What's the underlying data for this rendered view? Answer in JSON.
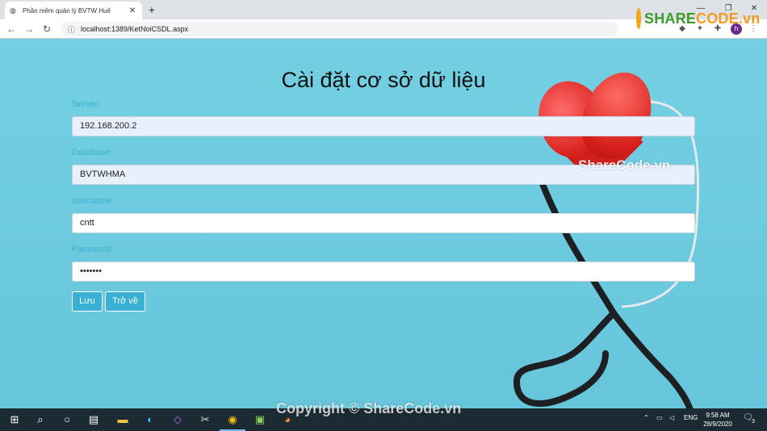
{
  "browser": {
    "tab_title": "Phần mềm quản lý BVTW Huế",
    "tab_favicon": "globe-icon",
    "url": "localhost:1389/KetNoiCSDL.aspx",
    "profile_initial": "h"
  },
  "watermark": {
    "logo_prefix": "SHARE",
    "logo_suffix": "CODE.vn",
    "site_text": "ShareCode.vn",
    "copyright_text": "Copyright © ShareCode.vn"
  },
  "form": {
    "heading": "Cài đặt cơ sở dữ liệu",
    "fields": [
      {
        "label": "Server:",
        "value": "192.168.200.2"
      },
      {
        "label": "Database:",
        "value": "BVTWHMA"
      },
      {
        "label": "username:",
        "value": "cntt"
      },
      {
        "label": "Password:",
        "value": "•••••••"
      }
    ],
    "save_label": "Lưu",
    "back_label": "Trở về"
  },
  "taskbar": {
    "language": "ENG",
    "time": "9:58 AM",
    "date": "28/9/2020",
    "notification_count": "3"
  },
  "colors": {
    "page_background": "#6ccbdf",
    "label_color": "#3fb0d0",
    "button_color": "#3ab0d4"
  }
}
